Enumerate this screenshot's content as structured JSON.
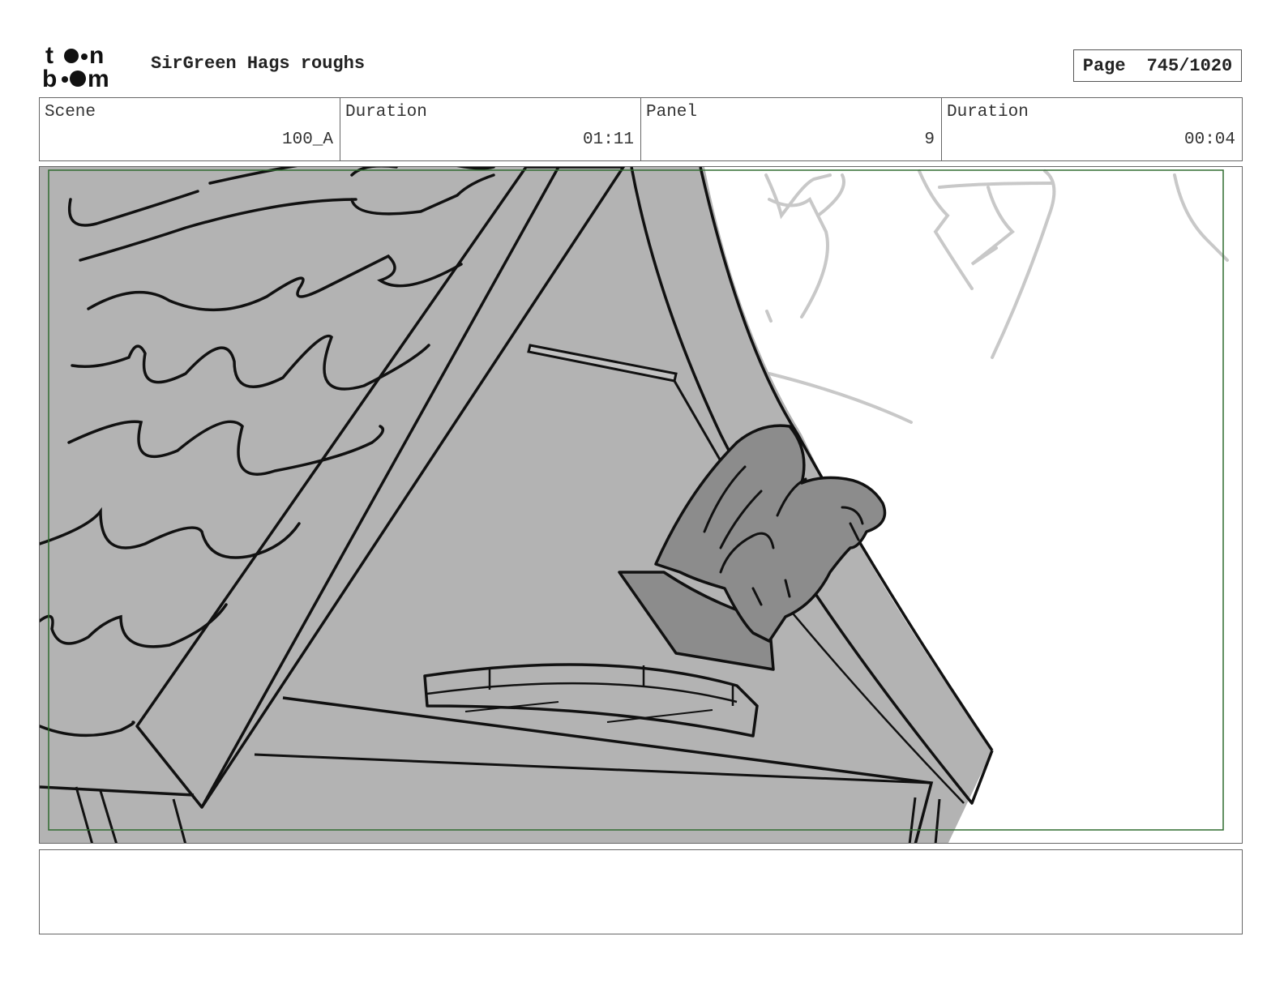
{
  "header": {
    "logo_text": "toon boom",
    "project_title": "SirGreen Hags roughs",
    "page_label": "Page",
    "page_number": "745/1020"
  },
  "info": {
    "scene_label": "Scene",
    "scene_value": "100_A",
    "scene_duration_label": "Duration",
    "scene_duration_value": "01:11",
    "panel_label": "Panel",
    "panel_value": "9",
    "panel_duration_label": "Duration",
    "panel_duration_value": "00:04"
  },
  "notes": {
    "text": ""
  },
  "colors": {
    "roof_fill": "#b3b3b3",
    "gargoyle_fill": "#8c8c8c",
    "safe_frame": "#2f6b2f",
    "sketch_line": "#c8c8c8"
  }
}
